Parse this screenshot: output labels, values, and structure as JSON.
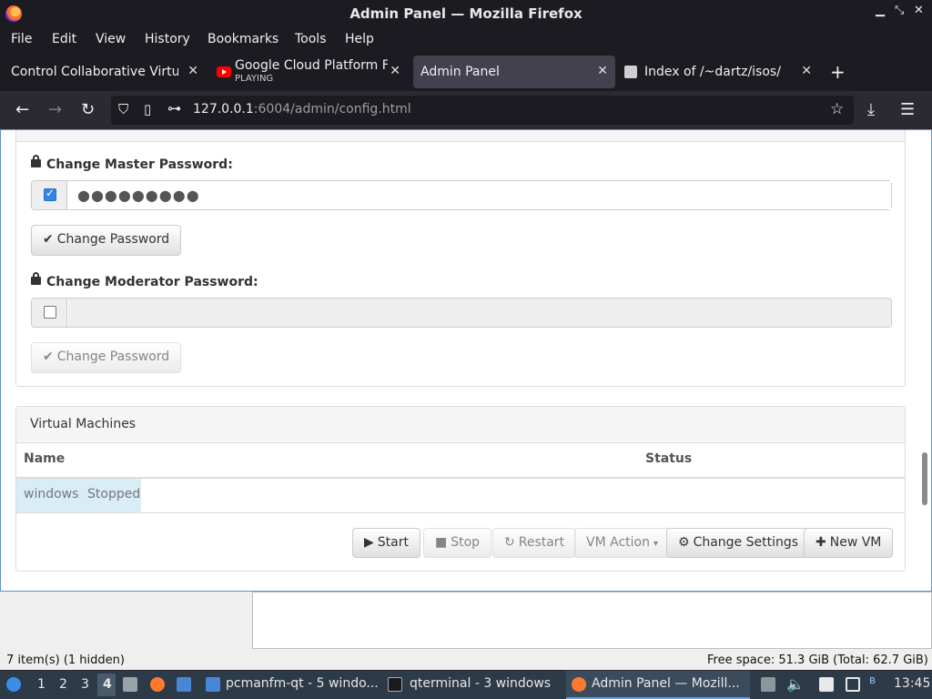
{
  "window": {
    "title": "Admin Panel — Mozilla Firefox"
  },
  "menu": [
    "File",
    "Edit",
    "View",
    "History",
    "Bookmarks",
    "Tools",
    "Help"
  ],
  "tabs": [
    {
      "title": "Control Collaborative Virtual"
    },
    {
      "title": "Google Cloud Platform Fr",
      "subtitle": "PLAYING"
    },
    {
      "title": "Admin Panel"
    },
    {
      "title": "Index of /~dartz/isos/"
    }
  ],
  "url": {
    "host": "127.0.0.1",
    "rest": ":6004/admin/config.html"
  },
  "master": {
    "label": "Change Master Password:",
    "value": "●●●●●●●●●",
    "button": "Change Password"
  },
  "moderator": {
    "label": "Change Moderator Password:",
    "value": "",
    "button": "Change Password"
  },
  "vms": {
    "heading": "Virtual Machines",
    "columns": [
      "Name",
      "Status"
    ],
    "rows": [
      {
        "name": "windows",
        "status": "Stopped"
      }
    ],
    "buttons": {
      "start": "Start",
      "stop": "Stop",
      "restart": "Restart",
      "vm_action": "VM Action",
      "change_settings": "Change Settings",
      "new_vm": "New VM"
    }
  },
  "file_manager": {
    "status_left": "7 item(s) (1 hidden)",
    "status_right": "Free space: 51.3 GiB (Total: 62.7 GiB)"
  },
  "taskbar": {
    "workspaces": [
      "1",
      "2",
      "3",
      "4"
    ],
    "tasks": [
      "pcmanfm-qt - 5 windo...",
      "qterminal - 3 windows",
      "Admin Panel — Mozill..."
    ],
    "clock": "13:45"
  }
}
